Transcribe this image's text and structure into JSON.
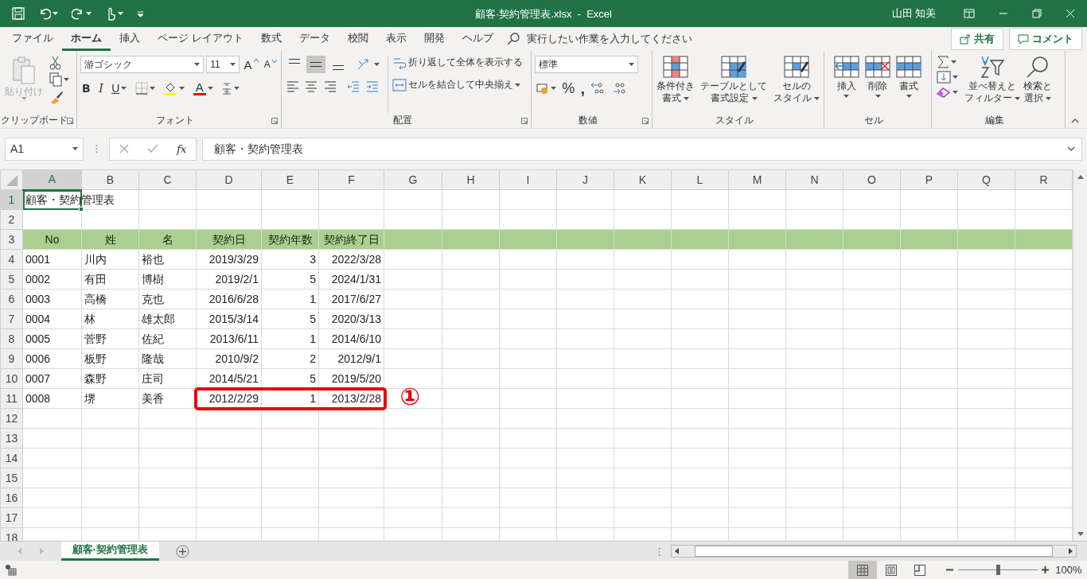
{
  "title_bar": {
    "title": "顧客·契約管理表.xlsx  -  Excel",
    "user": "山田 知美"
  },
  "ribbon_tabs": [
    {
      "label": "ファイル",
      "selected": false
    },
    {
      "label": "ホーム",
      "selected": true
    },
    {
      "label": "挿入",
      "selected": false
    },
    {
      "label": "ページ レイアウト",
      "selected": false
    },
    {
      "label": "数式",
      "selected": false
    },
    {
      "label": "データ",
      "selected": false
    },
    {
      "label": "校閲",
      "selected": false
    },
    {
      "label": "表示",
      "selected": false
    },
    {
      "label": "開発",
      "selected": false
    },
    {
      "label": "ヘルプ",
      "selected": false
    }
  ],
  "tell_me": {
    "placeholder": "実行したい作業を入力してください"
  },
  "share_button": "共有",
  "comment_button": "コメント",
  "ribbon_groups": [
    {
      "kind": "clipboard",
      "label": "クリップボード",
      "launcher": true,
      "paste": {
        "label": "貼り付け",
        "disabled": true
      }
    },
    {
      "kind": "font",
      "label": "フォント",
      "launcher": true,
      "font_name": "游ゴシック",
      "font_size": "11",
      "grow": "A",
      "shrink": "A",
      "bold": "B",
      "italic": "I",
      "underline": "U",
      "font_color": "A"
    },
    {
      "kind": "alignment",
      "label": "配置",
      "launcher": true,
      "vertical": [
        {
          "kind": "top",
          "selected": false
        },
        {
          "kind": "middle",
          "selected": true
        },
        {
          "kind": "bottom",
          "selected": false
        }
      ],
      "wrap_text": "折り返して全体を表示する",
      "merge": "セルを結合して中央揃え"
    },
    {
      "kind": "number",
      "label": "数値",
      "launcher": true,
      "format": "標準",
      "percent": "%",
      "comma": ","
    },
    {
      "kind": "styles",
      "label": "スタイル",
      "buttons": [
        {
          "kind": "conditional",
          "lines": [
            "条件付き",
            "書式"
          ],
          "dropdown": true
        },
        {
          "kind": "table",
          "lines": [
            "テーブルとして",
            "書式設定"
          ],
          "dropdown": true
        },
        {
          "kind": "cell_styles",
          "lines": [
            "セルの",
            "スタイル"
          ],
          "dropdown": true
        }
      ]
    },
    {
      "kind": "cells",
      "label": "セル",
      "buttons": [
        {
          "kind": "insert",
          "lines": [
            "挿入"
          ],
          "dropdown": true
        },
        {
          "kind": "delete",
          "lines": [
            "削除"
          ],
          "dropdown": true
        },
        {
          "kind": "format",
          "lines": [
            "書式"
          ],
          "dropdown": true
        }
      ]
    },
    {
      "kind": "editing",
      "label": "編集",
      "buttons": [
        {
          "kind": "sort",
          "lines": [
            "並べ替えと",
            "フィルター"
          ],
          "dropdown": true
        },
        {
          "kind": "find",
          "lines": [
            "検索と",
            "選択"
          ],
          "dropdown": true
        }
      ]
    }
  ],
  "formula_bar": {
    "name_box": "A1",
    "fx": "fx",
    "formula": "顧客・契約管理表"
  },
  "sheet": {
    "callout": "①",
    "columns": [
      {
        "label": "A",
        "selected": true
      },
      {
        "label": "B",
        "selected": false
      },
      {
        "label": "C",
        "selected": false
      },
      {
        "label": "D",
        "selected": false
      },
      {
        "label": "E",
        "selected": false
      },
      {
        "label": "F",
        "selected": false
      },
      {
        "label": "G",
        "selected": false
      },
      {
        "label": "H",
        "selected": false
      },
      {
        "label": "I",
        "selected": false
      },
      {
        "label": "J",
        "selected": false
      },
      {
        "label": "K",
        "selected": false
      },
      {
        "label": "L",
        "selected": false
      },
      {
        "label": "M",
        "selected": false
      },
      {
        "label": "N",
        "selected": false
      },
      {
        "label": "O",
        "selected": false
      },
      {
        "label": "P",
        "selected": false
      },
      {
        "label": "Q",
        "selected": false
      },
      {
        "label": "R",
        "selected": false
      }
    ],
    "rows": [
      {
        "label": "1",
        "kind": "title",
        "selected": true,
        "cells": [
          "顧客・契約管理表"
        ]
      },
      {
        "label": "2",
        "kind": "blank",
        "selected": false
      },
      {
        "label": "3",
        "kind": "header",
        "selected": false,
        "cells": [
          "No",
          "姓",
          "名",
          "契約日",
          "契約年数",
          "契約終了日"
        ]
      },
      {
        "label": "4",
        "kind": "data",
        "selected": false,
        "highlighted": false,
        "cells": [
          "0001",
          "川内",
          "裕也",
          "2019/3/29",
          "3",
          "2022/3/28"
        ]
      },
      {
        "label": "5",
        "kind": "data",
        "selected": false,
        "highlighted": false,
        "cells": [
          "0002",
          "有田",
          "博樹",
          "2019/2/1",
          "5",
          "2024/1/31"
        ]
      },
      {
        "label": "6",
        "kind": "data",
        "selected": false,
        "highlighted": false,
        "cells": [
          "0003",
          "高橋",
          "克也",
          "2016/6/28",
          "1",
          "2017/6/27"
        ]
      },
      {
        "label": "7",
        "kind": "data",
        "selected": false,
        "highlighted": false,
        "cells": [
          "0004",
          "林",
          "雄太郎",
          "2015/3/14",
          "5",
          "2020/3/13"
        ]
      },
      {
        "label": "8",
        "kind": "data",
        "selected": false,
        "highlighted": false,
        "cells": [
          "0005",
          "菅野",
          "佐紀",
          "2013/6/11",
          "1",
          "2014/6/10"
        ]
      },
      {
        "label": "9",
        "kind": "data",
        "selected": false,
        "highlighted": false,
        "cells": [
          "0006",
          "板野",
          "隆哉",
          "2010/9/2",
          "2",
          "2012/9/1"
        ]
      },
      {
        "label": "10",
        "kind": "data",
        "selected": false,
        "highlighted": false,
        "cells": [
          "0007",
          "森野",
          "庄司",
          "2014/5/21",
          "5",
          "2019/5/20"
        ]
      },
      {
        "label": "11",
        "kind": "data",
        "selected": false,
        "highlighted": true,
        "cells": [
          "0008",
          "堺",
          "美香",
          "2012/2/29",
          "1",
          "2013/2/28"
        ]
      },
      {
        "label": "12",
        "kind": "blank",
        "selected": false
      },
      {
        "label": "13",
        "kind": "blank",
        "selected": false
      },
      {
        "label": "14",
        "kind": "blank",
        "selected": false
      },
      {
        "label": "15",
        "kind": "blank",
        "selected": false
      },
      {
        "label": "16",
        "kind": "blank",
        "selected": false
      },
      {
        "label": "17",
        "kind": "blank",
        "selected": false
      },
      {
        "label": "18",
        "kind": "blank",
        "selected": false
      }
    ]
  },
  "sheet_tabs": [
    {
      "label": "顧客·契約管理表",
      "selected": true
    }
  ],
  "status_bar": {
    "views": [
      {
        "kind": "normal",
        "selected": true
      },
      {
        "kind": "page_layout",
        "selected": false
      },
      {
        "kind": "page_break",
        "selected": false
      }
    ],
    "zoom": {
      "level": 0.5,
      "reading": "100%"
    }
  }
}
